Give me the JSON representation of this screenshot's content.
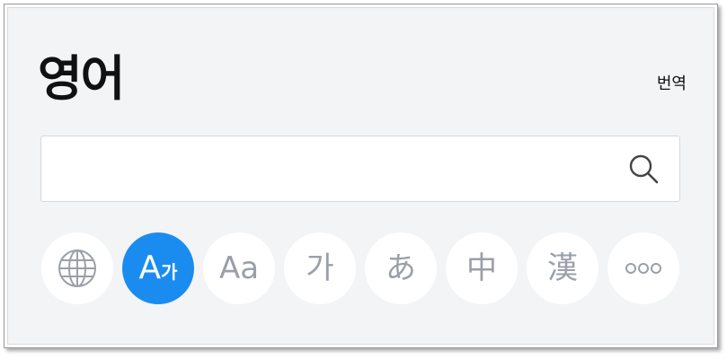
{
  "header": {
    "title": "영어",
    "translate_link": "번역"
  },
  "search": {
    "value": "",
    "placeholder": "",
    "icon": "search-icon"
  },
  "categories": [
    {
      "id": "global",
      "icon": "globe-icon",
      "label": ""
    },
    {
      "id": "en-ko",
      "label_main": "A",
      "label_sub": "가",
      "active": true
    },
    {
      "id": "en-en",
      "label": "Aa"
    },
    {
      "id": "korean",
      "label": "가"
    },
    {
      "id": "japanese",
      "label": "あ"
    },
    {
      "id": "chinese",
      "label": "中"
    },
    {
      "id": "hanja",
      "label": "漢"
    },
    {
      "id": "more",
      "icon": "more-icon",
      "label": ""
    }
  ],
  "colors": {
    "accent": "#1a8cf0",
    "panel_bg": "#f3f4f6",
    "chip_text": "#9a9fa8"
  }
}
